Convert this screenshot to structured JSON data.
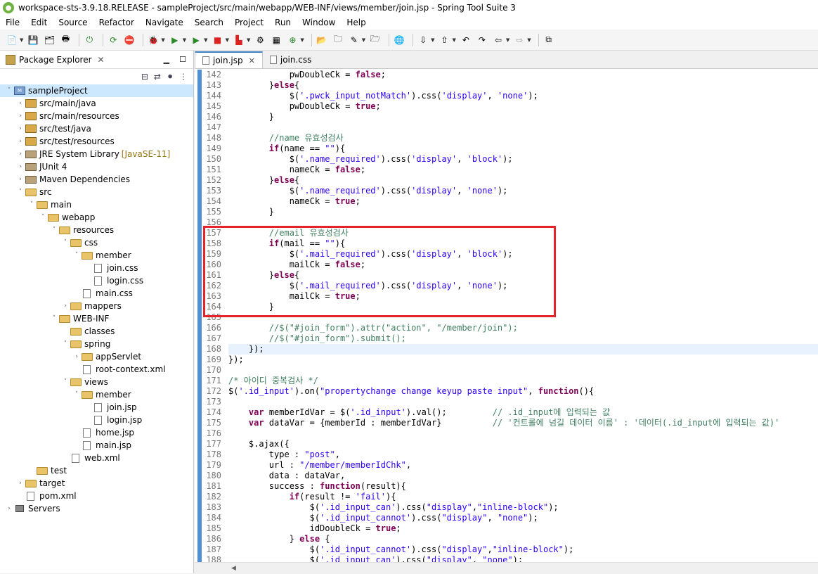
{
  "window": {
    "title": "workspace-sts-3.9.18.RELEASE - sampleProject/src/main/webapp/WEB-INF/views/member/join.jsp - Spring Tool Suite 3"
  },
  "menu": [
    "File",
    "Edit",
    "Source",
    "Refactor",
    "Navigate",
    "Search",
    "Project",
    "Run",
    "Window",
    "Help"
  ],
  "package_explorer": {
    "title": "Package Explorer",
    "close": "✕",
    "tree": [
      {
        "label": "sampleProject",
        "depth": 0,
        "tw": "˅",
        "icon": "proj",
        "sel": true
      },
      {
        "label": "src/main/java",
        "depth": 1,
        "tw": "›",
        "icon": "pkg"
      },
      {
        "label": "src/main/resources",
        "depth": 1,
        "tw": "›",
        "icon": "pkg"
      },
      {
        "label": "src/test/java",
        "depth": 1,
        "tw": "›",
        "icon": "pkg"
      },
      {
        "label": "src/test/resources",
        "depth": 1,
        "tw": "›",
        "icon": "pkg"
      },
      {
        "label": "JRE System Library",
        "sub": "[JavaSE-11]",
        "depth": 1,
        "tw": "›",
        "icon": "lib"
      },
      {
        "label": "JUnit 4",
        "depth": 1,
        "tw": "›",
        "icon": "lib"
      },
      {
        "label": "Maven Dependencies",
        "depth": 1,
        "tw": "›",
        "icon": "lib"
      },
      {
        "label": "src",
        "depth": 1,
        "tw": "˅",
        "icon": "folder"
      },
      {
        "label": "main",
        "depth": 2,
        "tw": "˅",
        "icon": "folder"
      },
      {
        "label": "webapp",
        "depth": 3,
        "tw": "˅",
        "icon": "folder"
      },
      {
        "label": "resources",
        "depth": 4,
        "tw": "˅",
        "icon": "folder"
      },
      {
        "label": "css",
        "depth": 5,
        "tw": "˅",
        "icon": "folder"
      },
      {
        "label": "member",
        "depth": 6,
        "tw": "˅",
        "icon": "folder"
      },
      {
        "label": "join.css",
        "depth": 7,
        "tw": "",
        "icon": "file"
      },
      {
        "label": "login.css",
        "depth": 7,
        "tw": "",
        "icon": "file"
      },
      {
        "label": "main.css",
        "depth": 6,
        "tw": "",
        "icon": "file"
      },
      {
        "label": "mappers",
        "depth": 5,
        "tw": "›",
        "icon": "folder"
      },
      {
        "label": "WEB-INF",
        "depth": 4,
        "tw": "˅",
        "icon": "folder"
      },
      {
        "label": "classes",
        "depth": 5,
        "tw": "",
        "icon": "folder"
      },
      {
        "label": "spring",
        "depth": 5,
        "tw": "˅",
        "icon": "folder"
      },
      {
        "label": "appServlet",
        "depth": 6,
        "tw": "›",
        "icon": "folder"
      },
      {
        "label": "root-context.xml",
        "depth": 6,
        "tw": "",
        "icon": "file"
      },
      {
        "label": "views",
        "depth": 5,
        "tw": "˅",
        "icon": "folder"
      },
      {
        "label": "member",
        "depth": 6,
        "tw": "˅",
        "icon": "folder"
      },
      {
        "label": "join.jsp",
        "depth": 7,
        "tw": "",
        "icon": "file"
      },
      {
        "label": "login.jsp",
        "depth": 7,
        "tw": "",
        "icon": "file"
      },
      {
        "label": "home.jsp",
        "depth": 6,
        "tw": "",
        "icon": "file"
      },
      {
        "label": "main.jsp",
        "depth": 6,
        "tw": "",
        "icon": "file"
      },
      {
        "label": "web.xml",
        "depth": 5,
        "tw": "",
        "icon": "file"
      },
      {
        "label": "test",
        "depth": 2,
        "tw": "",
        "icon": "folder"
      },
      {
        "label": "target",
        "depth": 1,
        "tw": "›",
        "icon": "folder"
      },
      {
        "label": "pom.xml",
        "depth": 1,
        "tw": "",
        "icon": "file"
      },
      {
        "label": "Servers",
        "depth": 0,
        "tw": "›",
        "icon": "srv"
      }
    ]
  },
  "tabs": [
    {
      "label": "join.jsp",
      "active": true,
      "close": "✕"
    },
    {
      "label": "join.css",
      "active": false
    }
  ],
  "code": [
    {
      "n": "142",
      "t": "            pwDoubleCk = <k>false</k>;"
    },
    {
      "n": "143",
      "t": "        }<k>else</k>{"
    },
    {
      "n": "144",
      "t": "            $(<s>'.pwck_input_notMatch'</s>).css(<s>'display'</s>, <s>'none'</s>);"
    },
    {
      "n": "145",
      "t": "            pwDoubleCk = <k>true</k>;"
    },
    {
      "n": "146",
      "t": "        }"
    },
    {
      "n": "147",
      "t": ""
    },
    {
      "n": "148",
      "t": "        <c>//name 유효성검사</c>"
    },
    {
      "n": "149",
      "t": "        <k>if</k>(name == <s>\"\"</s>){"
    },
    {
      "n": "150",
      "t": "            $(<s>'.name_required'</s>).css(<s>'display'</s>, <s>'block'</s>);"
    },
    {
      "n": "151",
      "t": "            nameCk = <k>false</k>;"
    },
    {
      "n": "152",
      "t": "        }<k>else</k>{"
    },
    {
      "n": "153",
      "t": "            $(<s>'.name_required'</s>).css(<s>'display'</s>, <s>'none'</s>);"
    },
    {
      "n": "154",
      "t": "            nameCk = <k>true</k>;"
    },
    {
      "n": "155",
      "t": "        }"
    },
    {
      "n": "156",
      "t": ""
    },
    {
      "n": "157",
      "t": "        <c>//email 유효성검사</c>"
    },
    {
      "n": "158",
      "t": "        <k>if</k>(mail == <s>\"\"</s>){"
    },
    {
      "n": "159",
      "t": "            $(<s>'.mail_required'</s>).css(<s>'display'</s>, <s>'block'</s>);"
    },
    {
      "n": "160",
      "t": "            mailCk = <k>false</k>;"
    },
    {
      "n": "161",
      "t": "        }<k>else</k>{"
    },
    {
      "n": "162",
      "t": "            $(<s>'.mail_required'</s>).css(<s>'display'</s>, <s>'none'</s>);"
    },
    {
      "n": "163",
      "t": "            mailCk = <k>true</k>;"
    },
    {
      "n": "164",
      "t": "        }"
    },
    {
      "n": "165",
      "t": ""
    },
    {
      "n": "166",
      "t": "        <c>//$(\"#join_form\").attr(\"action\", \"/member/join\");</c>"
    },
    {
      "n": "167",
      "t": "        <c>//$(\"#join_form\").submit();</c>"
    },
    {
      "n": "168",
      "t": "    });",
      "cur": true
    },
    {
      "n": "169",
      "t": "});"
    },
    {
      "n": "170",
      "t": ""
    },
    {
      "n": "171",
      "t": "<c>/* 아이디 중복검사 */</c>"
    },
    {
      "n": "172",
      "t": "$(<s>'.id_input'</s>).on(<s>\"propertychange change keyup paste input\"</s>, <k>function</k>(){"
    },
    {
      "n": "173",
      "t": ""
    },
    {
      "n": "174",
      "t": "    <k>var</k> memberIdVar = $(<s>'.id_input'</s>).val();         <c>// .id_input에 입력되는 값</c>"
    },
    {
      "n": "175",
      "t": "    <k>var</k> dataVar = {memberId : memberIdVar}          <c>// '컨트롤에 넘길 데이터 이름' : '데이터(.id_input에 입력되는 값)'</c>"
    },
    {
      "n": "176",
      "t": ""
    },
    {
      "n": "177",
      "t": "    $.ajax({"
    },
    {
      "n": "178",
      "t": "        type : <s>\"post\"</s>,"
    },
    {
      "n": "179",
      "t": "        url : <s>\"/member/memberIdChk\"</s>,"
    },
    {
      "n": "180",
      "t": "        data : dataVar,"
    },
    {
      "n": "181",
      "t": "        success : <k>function</k>(result){"
    },
    {
      "n": "182",
      "t": "            <k>if</k>(result != <s>'fail'</s>){"
    },
    {
      "n": "183",
      "t": "                $(<s>'.id_input_can'</s>).css(<s>\"display\"</s>,<s>\"inline-block\"</s>);"
    },
    {
      "n": "184",
      "t": "                $(<s>'.id_input_cannot'</s>).css(<s>\"display\"</s>, <s>\"none\"</s>);"
    },
    {
      "n": "185",
      "t": "                idDoubleCk = <k>true</k>;"
    },
    {
      "n": "186",
      "t": "            } <k>else</k> {"
    },
    {
      "n": "187",
      "t": "                $(<s>'.id_input_cannot'</s>).css(<s>\"display\"</s>,<s>\"inline-block\"</s>);"
    },
    {
      "n": "188",
      "t": "                $(<s>'.id_input_can'</s>).css(<s>\"display\"</s>, <s>\"none\"</s>);"
    }
  ]
}
